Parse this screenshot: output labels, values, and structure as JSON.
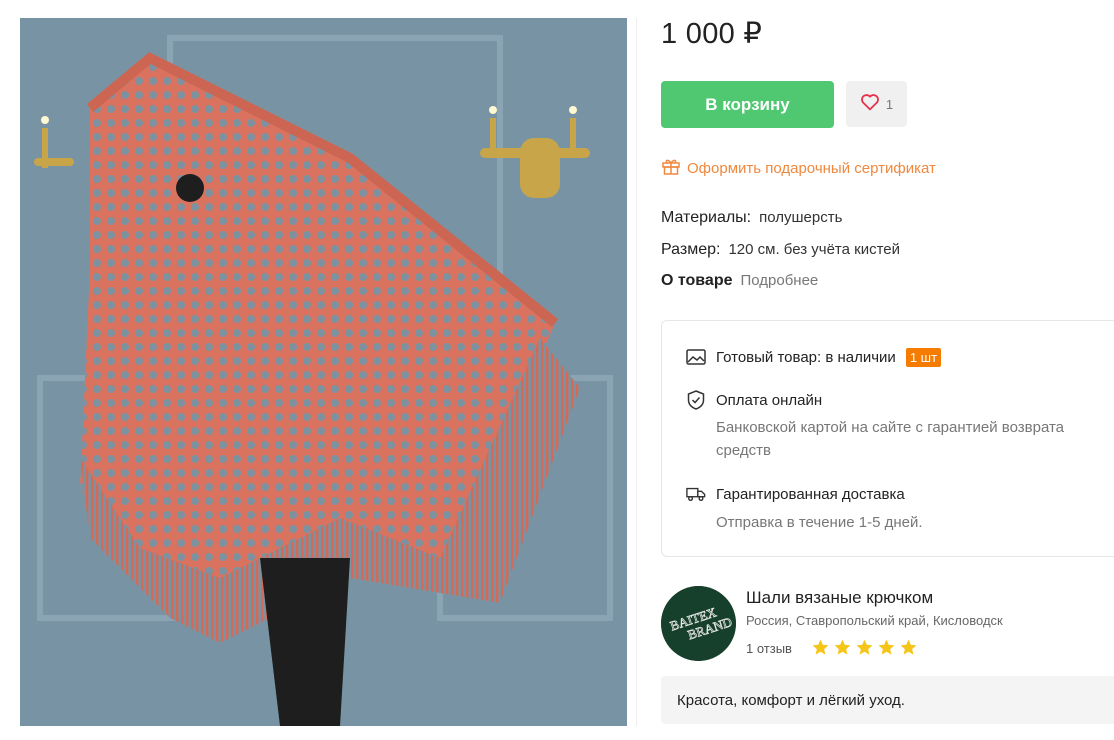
{
  "product": {
    "price": "1 000 ₽",
    "add_to_cart": "В корзину",
    "favorites_count": "1",
    "gift_certificate": "Оформить подарочный сертификат",
    "attributes": {
      "materials_label": "Материалы:",
      "materials_value": "полушерсть",
      "size_label": "Размер:",
      "size_value": "120 см. без учёта кистей",
      "about_label": "О товаре",
      "about_link": "Подробнее"
    }
  },
  "info": {
    "stock_label": "Готовый товар: в наличии",
    "stock_badge": "1 шт",
    "payment_title": "Оплата онлайн",
    "payment_desc": "Банковской картой на сайте с гарантией возврата средств",
    "delivery_title": "Гарантированная доставка",
    "delivery_desc": "Отправка в течение 1-5 дней."
  },
  "shop": {
    "name": "Шали вязаные крючком",
    "location": "Россия, Ставропольский край, Кисловодск",
    "reviews": "1 отзыв",
    "rating": 5,
    "logo_text_line1": "BAITEX",
    "logo_text_line2": "BRAND"
  },
  "description": "Красота, комфорт и лёгкий уход.",
  "colors": {
    "accent_green": "#4fc871",
    "accent_orange": "#f0883e",
    "badge_orange": "#f57c00",
    "star_yellow": "#f5c518",
    "heart_red": "#e5334b"
  },
  "icons": {
    "favorite": "heart-icon",
    "gift": "gift-icon",
    "stock": "image-icon",
    "payment": "shield-check-icon",
    "delivery": "truck-icon",
    "rating": "star-icon"
  }
}
